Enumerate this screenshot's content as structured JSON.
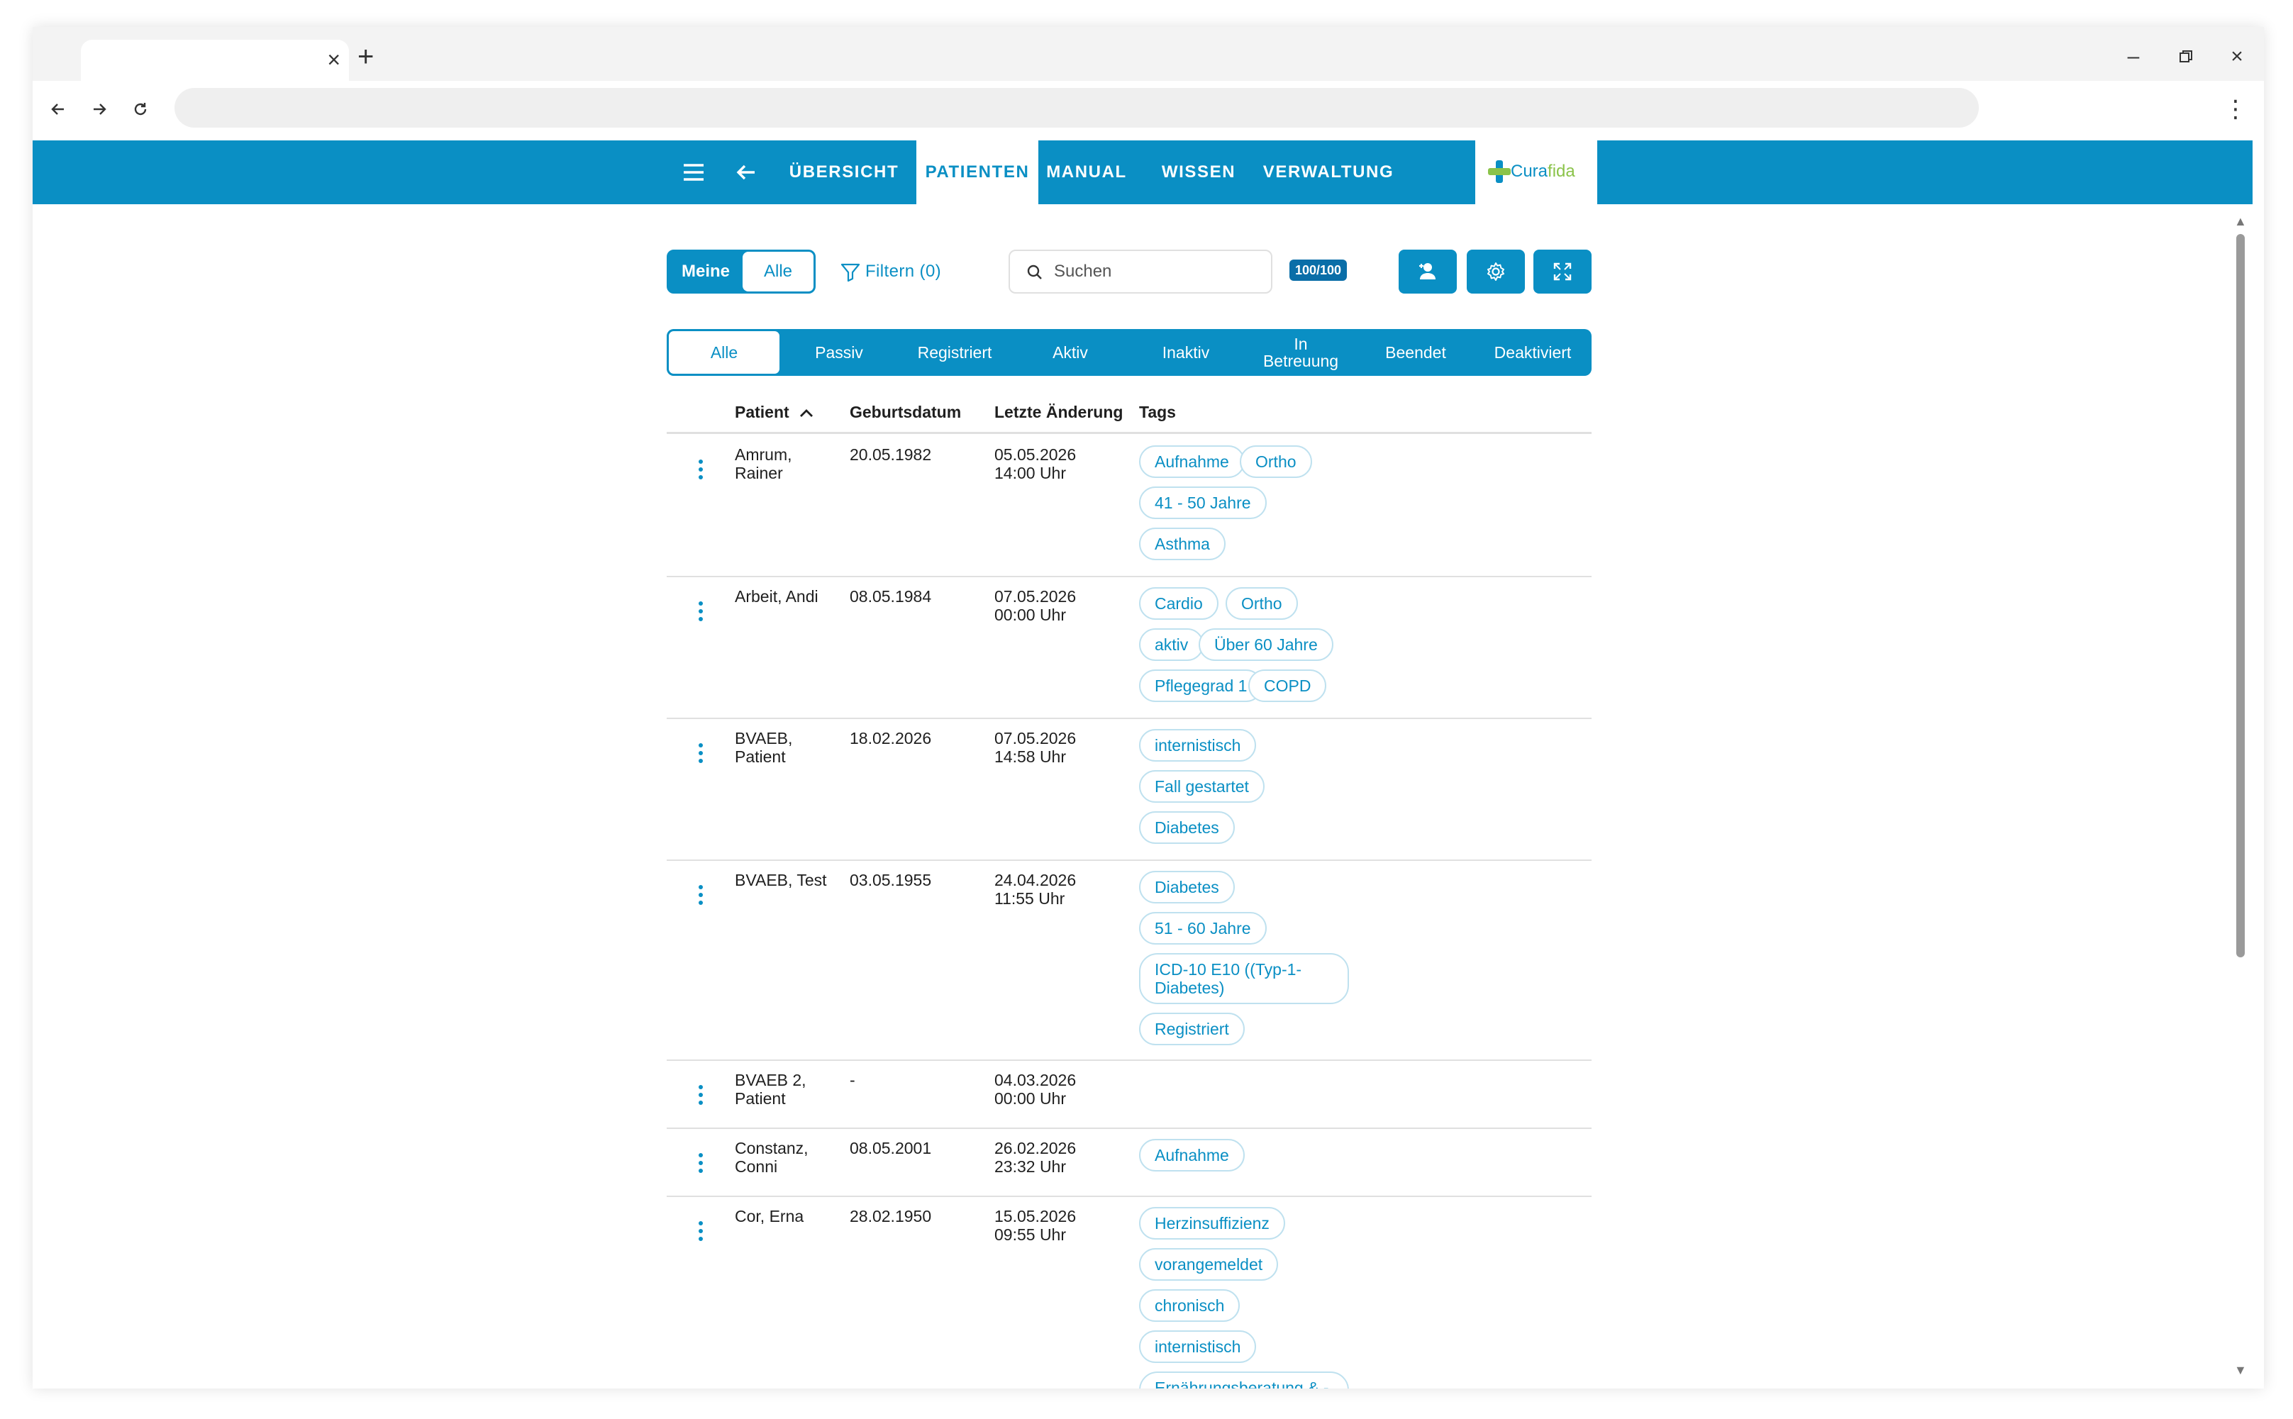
{
  "browser": {
    "tab_title": "",
    "address": "",
    "icons": [
      "close-icon",
      "plus-icon",
      "minimize-icon",
      "restore-icon",
      "back-icon",
      "forward-icon",
      "reload-icon",
      "more-vert-icon"
    ]
  },
  "header": {
    "nav": [
      "ÜBERSICHT",
      "PATIENTEN",
      "MANUAL",
      "WISSEN",
      "VERWALTUNG"
    ],
    "active_nav": "PATIENTEN",
    "logo_left": "Cura",
    "logo_right": "fida",
    "colors": {
      "primary": "#0a8fc4",
      "logo_green": "#8bc34a"
    }
  },
  "controls": {
    "scope_meine": "Meine",
    "scope_alle": "Alle",
    "filter_label": "Filtern (0)",
    "search_placeholder": "Suchen",
    "count": "100/100"
  },
  "status_tabs": [
    "Alle",
    "Passiv",
    "Registriert",
    "Aktiv",
    "Inaktiv",
    "In Betreuung",
    "Beendet",
    "Deaktiviert"
  ],
  "active_status": "Alle",
  "table": {
    "columns": {
      "patient": "Patient",
      "dob": "Geburtsdatum",
      "changed": "Letzte Änderung",
      "tags": "Tags"
    },
    "rows": [
      {
        "name1": "Amrum,",
        "name2": "Rainer",
        "dob": "20.05.1982",
        "date": "05.05.2026",
        "time": "14:00 Uhr",
        "tags": [
          "Aufnahme",
          "Ortho",
          "41 - 50 Jahre",
          "Asthma"
        ]
      },
      {
        "name1": "Arbeit, Andi",
        "name2": "",
        "dob": "08.05.1984",
        "date": "07.05.2026",
        "time": "00:00 Uhr",
        "tags": [
          "Cardio",
          "Ortho",
          "aktiv",
          "Über 60 Jahre",
          "Pflegegrad 1",
          "COPD"
        ]
      },
      {
        "name1": "BVAEB,",
        "name2": "Patient",
        "dob": "18.02.2026",
        "date": "07.05.2026",
        "time": "14:58 Uhr",
        "tags": [
          "internistisch",
          "Fall gestartet",
          "Diabetes"
        ]
      },
      {
        "name1": "BVAEB, Test",
        "name2": "",
        "dob": "03.05.1955",
        "date": "24.04.2026",
        "time": "11:55 Uhr",
        "tags": [
          "Diabetes",
          "51 - 60 Jahre",
          "ICD-10 E10 ((Typ-1-Diabetes)",
          "Registriert"
        ]
      },
      {
        "name1": "BVAEB 2,",
        "name2": "Patient",
        "dob": "-",
        "date": "04.03.2026",
        "time": "00:00 Uhr",
        "tags": []
      },
      {
        "name1": "Constanz,",
        "name2": "Conni",
        "dob": "08.05.2001",
        "date": "26.02.2026",
        "time": "23:32 Uhr",
        "tags": [
          "Aufnahme"
        ]
      },
      {
        "name1": "Cor, Erna",
        "name2": "",
        "dob": "28.02.1950",
        "date": "15.05.2026",
        "time": "09:55 Uhr",
        "tags": [
          "Herzinsuffizienz",
          "vorangemeldet",
          "chronisch",
          "internistisch",
          "Ernährungsberatung & -therapie"
        ]
      }
    ]
  }
}
